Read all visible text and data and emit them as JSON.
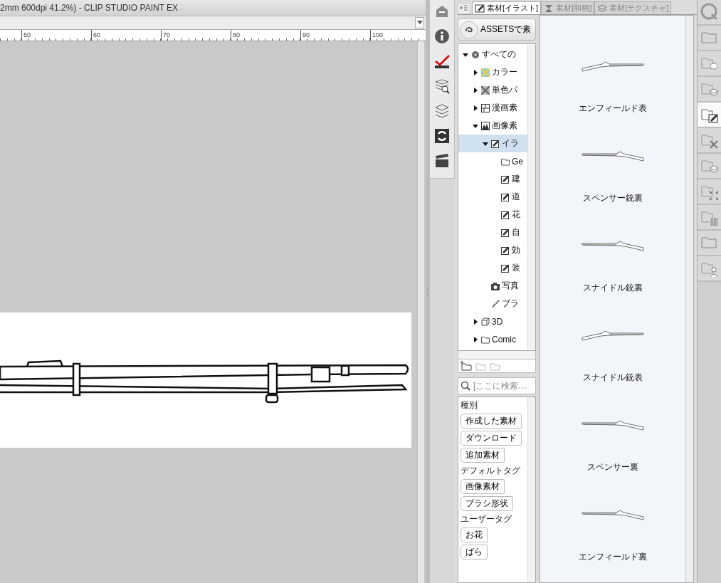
{
  "window": {
    "title": "2mm 600dpi 41.2%)  - CLIP STUDIO PAINT EX"
  },
  "ruler": {
    "labels": [
      "50",
      "60",
      "70",
      "80",
      "90",
      "100"
    ]
  },
  "tabs": [
    {
      "label": "素材[イラスト]",
      "kind": "illust",
      "selected": true
    },
    {
      "label": "素材[和柄]",
      "kind": "pattern",
      "selected": false
    },
    {
      "label": "素材[テクスチャ]",
      "kind": "texture",
      "selected": false
    }
  ],
  "assets_button": {
    "label": "ASSETSで素"
  },
  "tree": [
    {
      "label": "すべての",
      "kind": "all",
      "expanded": true,
      "selected": false,
      "children": [
        {
          "label": "カラー",
          "kind": "color",
          "expanded": false,
          "selected": false
        },
        {
          "label": "単色パ",
          "kind": "mono",
          "expanded": false,
          "selected": false
        },
        {
          "label": "漫画素",
          "kind": "manga",
          "expanded": false,
          "selected": false
        },
        {
          "label": "画像素",
          "kind": "image",
          "expanded": true,
          "selected": false,
          "children": [
            {
              "label": "イラ",
              "kind": "illust",
              "expanded": true,
              "selected": true,
              "children": [
                {
                  "label": "Ge",
                  "kind": "folder",
                  "selected": false
                },
                {
                  "label": "建",
                  "kind": "illust",
                  "selected": false
                },
                {
                  "label": "道",
                  "kind": "illust",
                  "selected": false
                },
                {
                  "label": "花",
                  "kind": "illust",
                  "selected": false
                },
                {
                  "label": "自",
                  "kind": "illust",
                  "selected": false
                },
                {
                  "label": "効",
                  "kind": "illust",
                  "selected": false
                },
                {
                  "label": "装",
                  "kind": "illust",
                  "selected": false
                }
              ]
            },
            {
              "label": "写真",
              "kind": "photo",
              "selected": false
            },
            {
              "label": "ブラ",
              "kind": "brush",
              "selected": false
            }
          ]
        },
        {
          "label": "3D",
          "kind": "cube",
          "expanded": false,
          "selected": false
        },
        {
          "label": "Comic",
          "kind": "folder",
          "expanded": false,
          "selected": false
        }
      ]
    }
  ],
  "search": {
    "placeholder": "[ここに検索…"
  },
  "tag_groups": [
    {
      "title": "種別",
      "tags": [
        "作成した素材",
        "ダウンロード",
        "追加素材"
      ]
    },
    {
      "title": "デフォルトタグ",
      "tags": [
        "画像素材",
        "ブラシ形状"
      ]
    },
    {
      "title": "ユーザータグ",
      "tags": [
        "お花",
        "ばら"
      ]
    }
  ],
  "materials": [
    {
      "name": "エンフィールド表",
      "kind": "rifle-left"
    },
    {
      "name": "スペンサー銃裏",
      "kind": "rifle-right"
    },
    {
      "name": "スナイドル銃裏",
      "kind": "rifle-right"
    },
    {
      "name": "スナイドル銃表",
      "kind": "rifle-left"
    },
    {
      "name": "スペンサー裏",
      "kind": "rifle-right"
    },
    {
      "name": "エンフィールド裏",
      "kind": "rifle-right"
    }
  ],
  "side_tabs": [
    {
      "kind": "search",
      "selected": false
    },
    {
      "kind": "folder",
      "selected": false
    },
    {
      "kind": "balloon",
      "selected": false
    },
    {
      "kind": "stack",
      "selected": false
    },
    {
      "kind": "pen",
      "selected": true
    },
    {
      "kind": "spark",
      "selected": false
    },
    {
      "kind": "stack",
      "selected": false
    },
    {
      "kind": "burst",
      "selected": false
    },
    {
      "kind": "checker",
      "selected": false
    },
    {
      "kind": "folder",
      "selected": false
    },
    {
      "kind": "person",
      "selected": false
    }
  ]
}
